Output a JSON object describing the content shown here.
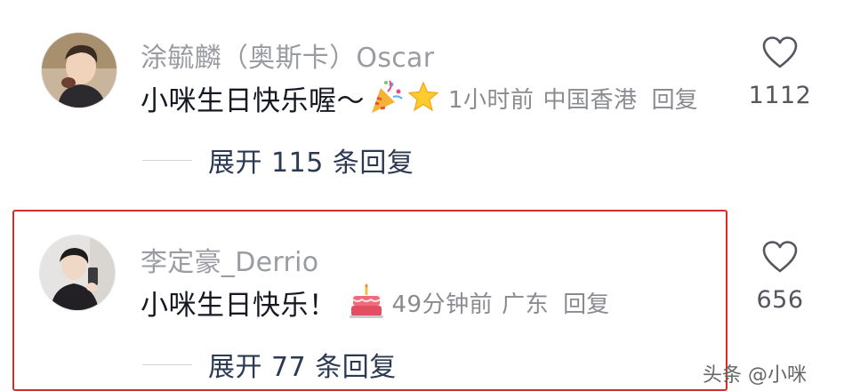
{
  "comments": [
    {
      "username": "涂毓麟（奥斯卡）Oscar",
      "text": "小咪生日快乐喔～",
      "emojis": [
        "party-popper-icon",
        "star-icon"
      ],
      "time": "1小时前",
      "location": "中国香港",
      "reply_label": "回复",
      "likes": "1112",
      "expand_label": "展开 115 条回复"
    },
    {
      "username": "李定豪_Derrio",
      "text": "小咪生日快乐！",
      "emojis": [
        "birthday-cake-icon"
      ],
      "time": "49分钟前",
      "location": "广东",
      "reply_label": "回复",
      "likes": "656",
      "expand_label": "展开 77 条回复"
    }
  ],
  "colors": {
    "highlight_border": "#d0302b",
    "username": "#9a9ca2",
    "body_text": "#161823",
    "meta": "#8a8b91",
    "expand_text": "#2b3a52"
  },
  "watermark_partial": "头条 @小咪"
}
